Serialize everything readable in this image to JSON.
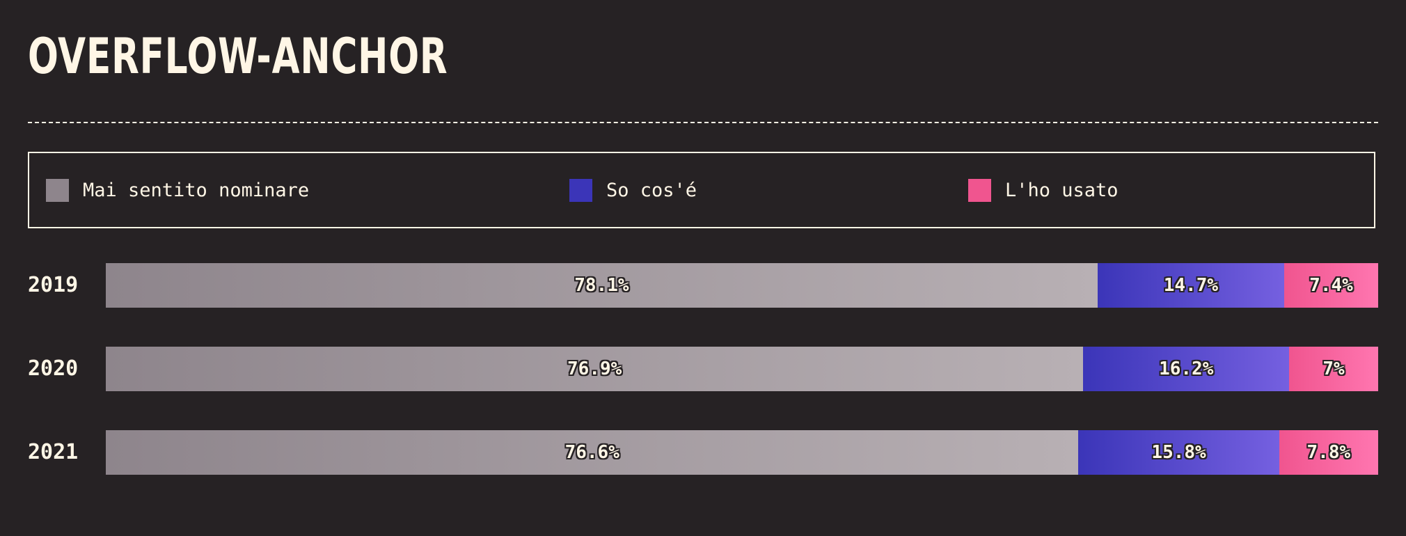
{
  "header": {
    "title": "OVERFLOW-ANCHOR"
  },
  "legend": [
    {
      "label": "Mai sentito nominare",
      "color": "#8e858c"
    },
    {
      "label": "So cos'é",
      "color": "#3b35b8"
    },
    {
      "label": "L'ho usato",
      "color": "#f0558f"
    }
  ],
  "chart_data": {
    "type": "bar",
    "orientation": "horizontal",
    "stacked": true,
    "categories": [
      "2019",
      "2020",
      "2021"
    ],
    "series": [
      {
        "name": "Mai sentito nominare",
        "values": [
          78.1,
          76.9,
          76.6
        ],
        "labels": [
          "78.1%",
          "76.9%",
          "76.6%"
        ],
        "color_from": "#8e858c",
        "color_to": "#b8b0b4"
      },
      {
        "name": "So cos'é",
        "values": [
          14.7,
          16.2,
          15.8
        ],
        "labels": [
          "14.7%",
          "16.2%",
          "15.8%"
        ],
        "color_from": "#3b35b8",
        "color_to": "#7560e0"
      },
      {
        "name": "L'ho usato",
        "values": [
          7.4,
          7,
          7.8
        ],
        "labels": [
          "7.4%",
          "7%",
          "7.8%"
        ],
        "color_from": "#f0558f",
        "color_to": "#ff76b0"
      }
    ],
    "xlim": [
      0,
      100
    ],
    "legend_position": "top"
  }
}
